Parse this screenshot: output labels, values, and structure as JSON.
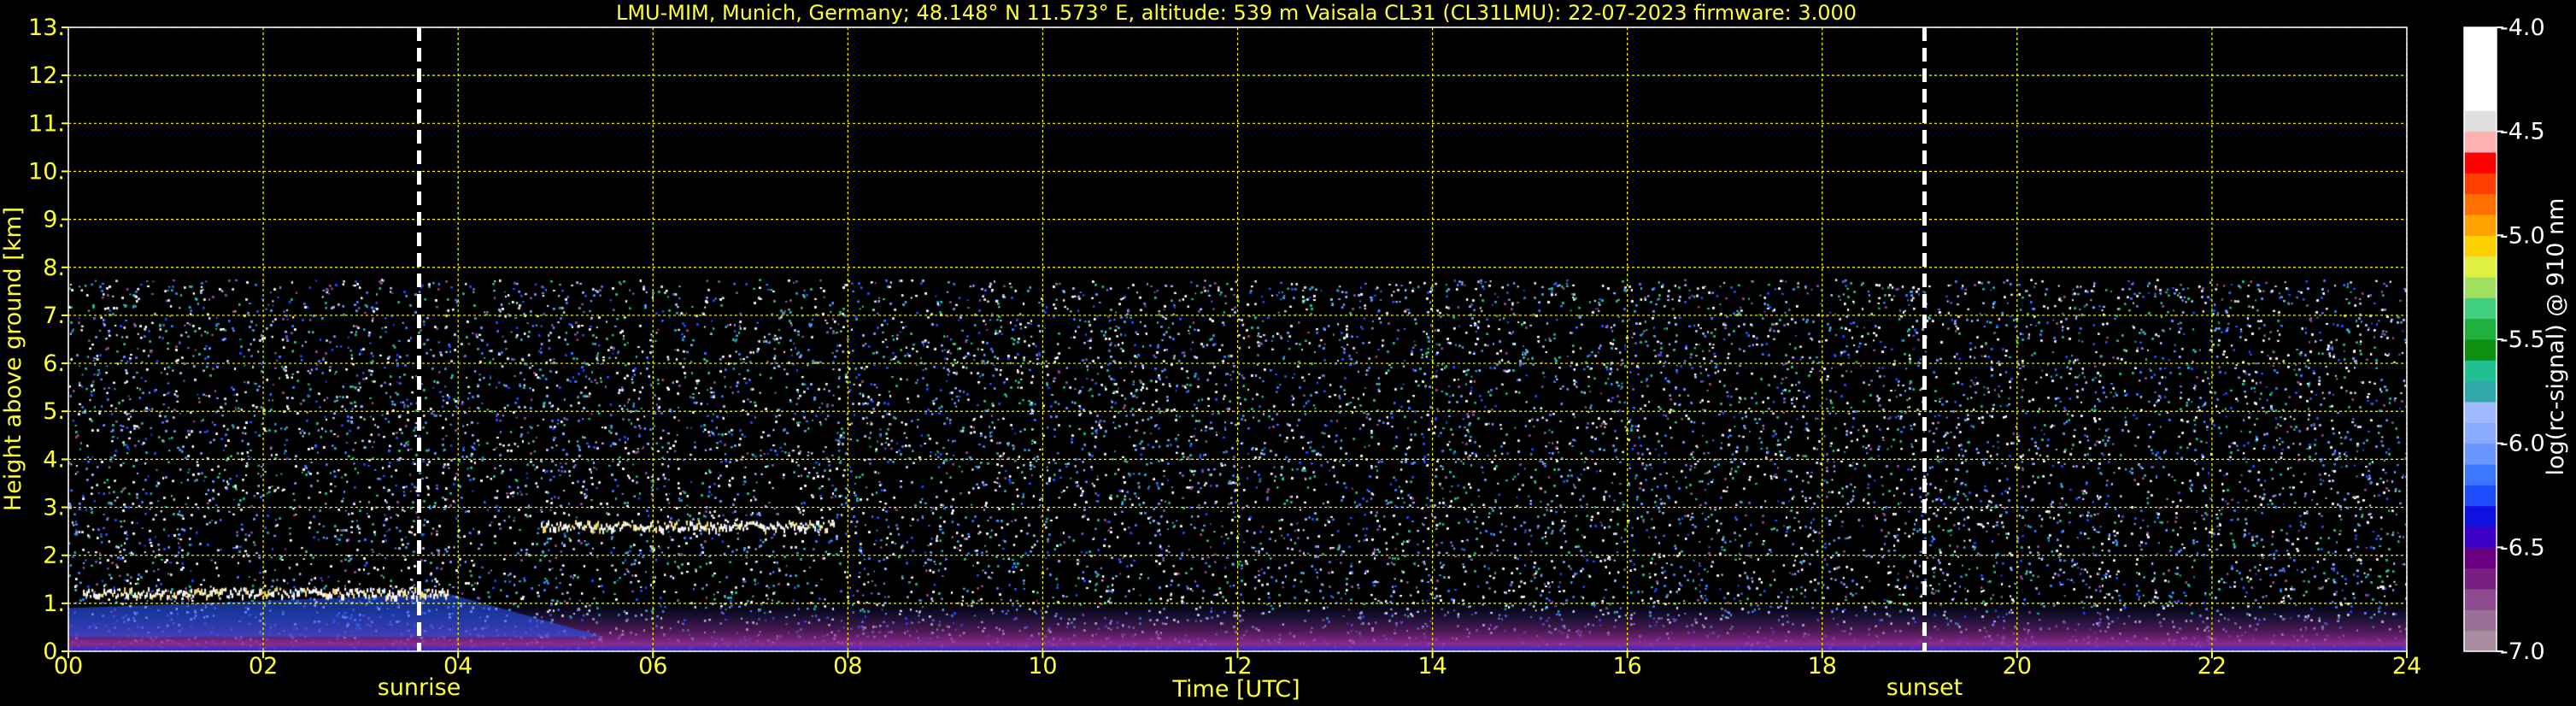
{
  "chart_data": {
    "type": "heatmap",
    "title": "LMU-MIM, Munich, Germany; 48.148° N 11.573° E, altitude: 539 m    Vaisala CL31 (CL31LMU): 22-07-2023    firmware: 3.000",
    "xlabel": "Time [UTC]",
    "ylabel": "Height above ground [km]",
    "xlim": [
      0,
      24
    ],
    "ylim": [
      0,
      13
    ],
    "x_ticks": [
      "00",
      "02",
      "04",
      "06",
      "08",
      "10",
      "12",
      "14",
      "16",
      "18",
      "20",
      "22",
      "24"
    ],
    "y_ticks": [
      "0.",
      "1.",
      "2.",
      "3.",
      "4.",
      "5.",
      "6.",
      "7.",
      "8.",
      "9.",
      "10.",
      "11.",
      "12.",
      "13."
    ],
    "grid": true,
    "data_top_km": 7.75,
    "events": [
      {
        "label": "sunrise",
        "time_h": 3.6
      },
      {
        "label": "sunset",
        "time_h": 19.05
      }
    ],
    "features": [
      {
        "feature": "cloud_layer",
        "t_start": 4.85,
        "t_end": 7.85,
        "height_km": 2.65
      },
      {
        "feature": "cloud_layer",
        "t_start": 0.15,
        "t_end": 3.9,
        "height_km": 1.25
      },
      {
        "feature": "aerosol_layer",
        "t_start": 0,
        "t_end": 24,
        "height_km": 0.35
      }
    ],
    "colorbar": {
      "label": "log(rc-signal) @ 910 nm",
      "ticks": [
        "-4.0",
        "-4.5",
        "-5.0",
        "-5.5",
        "-6.0",
        "-6.5",
        "-7.0"
      ],
      "range": [
        -7.0,
        -4.0
      ],
      "colors": [
        "#a88ca0",
        "#9a6f95",
        "#8d4b8d",
        "#7a1f82",
        "#6a0080",
        "#3a00c8",
        "#1010e0",
        "#1e4cff",
        "#3c78ff",
        "#6a96ff",
        "#8aaaff",
        "#a0b8ff",
        "#30a8a8",
        "#20c090",
        "#109010",
        "#20b040",
        "#40d080",
        "#a0e060",
        "#e0f040",
        "#ffd000",
        "#ffa000",
        "#ff7000",
        "#ff4000",
        "#ff0000",
        "#ffb0b0",
        "#e0e0e0",
        "#ffffff",
        "#ffffff",
        "#ffffff",
        "#ffffff"
      ]
    }
  }
}
